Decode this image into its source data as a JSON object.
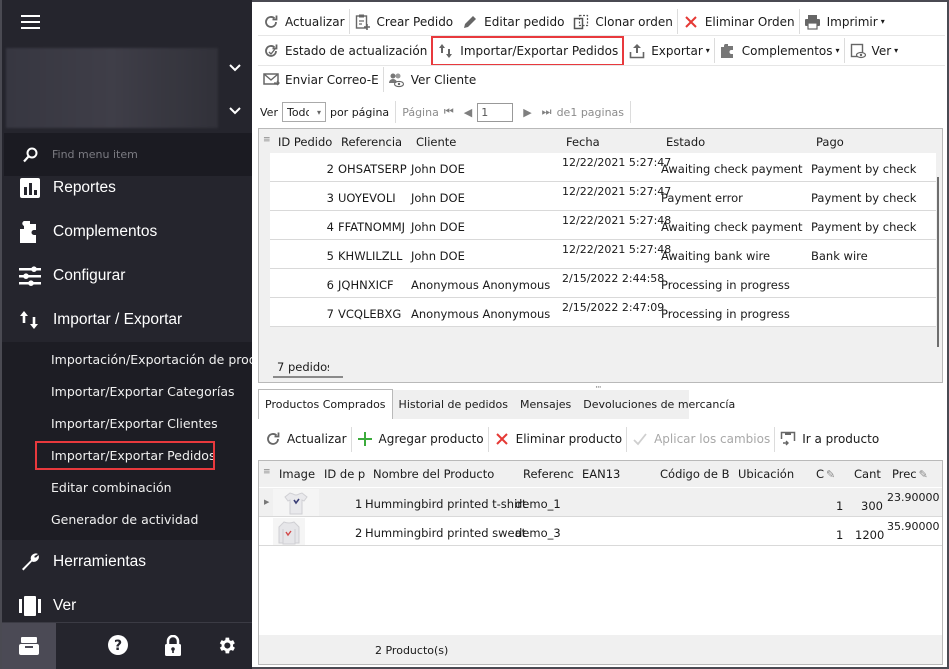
{
  "sidebar": {
    "search_placeholder": "Find menu item",
    "menu": [
      {
        "label": "Reportes",
        "icon": "bar-chart-icon"
      },
      {
        "label": "Complementos",
        "icon": "puzzle-icon"
      },
      {
        "label": "Configurar",
        "icon": "sliders-icon"
      },
      {
        "label": "Importar / Exportar",
        "icon": "import-export-icon"
      }
    ],
    "submenu": [
      {
        "label": "Importación/Exportación de prod..."
      },
      {
        "label": "Importar/Exportar Categorías"
      },
      {
        "label": "Importar/Exportar Clientes"
      },
      {
        "label": "Importar/Exportar Pedidos",
        "selected": true
      },
      {
        "label": "Editar combinación"
      },
      {
        "label": "Generador de actividad"
      }
    ],
    "menu_after": [
      {
        "label": "Herramientas",
        "icon": "wrench-icon"
      },
      {
        "label": "Ver",
        "icon": "view-columns-icon"
      }
    ]
  },
  "toolbar": {
    "row1": {
      "refresh": "Actualizar",
      "create_order": "Crear Pedido",
      "edit_order": "Editar pedido",
      "clone_order": "Clonar orden",
      "delete_order": "Eliminar Orden",
      "print": "Imprimir"
    },
    "row2": {
      "update_status": "Estado de actualización",
      "import_export_orders": "Importar/Exportar Pedidos",
      "export": "Exportar",
      "addons": "Complementos",
      "view": "Ver"
    },
    "row3": {
      "send_email": "Enviar Correo-E",
      "view_customer": "Ver Cliente"
    }
  },
  "pager": {
    "show_label": "Ver",
    "per_page_value": "Todo",
    "per_page_label": "por página",
    "page_label": "Página",
    "page_value": "1",
    "of_pages": "de1 paginas"
  },
  "orders": {
    "columns": [
      "ID Pedido",
      "Referencia",
      "Cliente",
      "Fecha",
      "Estado",
      "Pago"
    ],
    "rows": [
      {
        "id": "2",
        "ref": "OHSATSERP",
        "customer": "John DOE",
        "date": "12/22/2021 5:27:47",
        "status": "Awaiting check payment",
        "payment": "Payment by check"
      },
      {
        "id": "3",
        "ref": "UOYEVOLI",
        "customer": "John DOE",
        "date": "12/22/2021 5:27:47",
        "status": "Payment error",
        "payment": "Payment by check"
      },
      {
        "id": "4",
        "ref": "FFATNOMMJ",
        "customer": "John DOE",
        "date": "12/22/2021 5:27:48",
        "status": "Awaiting check payment",
        "payment": "Payment by check"
      },
      {
        "id": "5",
        "ref": "KHWLILZLL",
        "customer": "John DOE",
        "date": "12/22/2021 5:27:48",
        "status": "Awaiting bank wire",
        "payment": "Bank wire"
      },
      {
        "id": "6",
        "ref": "JQHNXICF",
        "customer": "Anonymous Anonymous",
        "date": "2/15/2022 2:44:58",
        "status": "Processing in progress",
        "payment": ""
      },
      {
        "id": "7",
        "ref": "VCQLEBXG",
        "customer": "Anonymous Anonymous",
        "date": "2/15/2022 2:47:09",
        "status": "Processing in progress",
        "payment": ""
      }
    ],
    "footer": "7 pedidos"
  },
  "tabs": [
    {
      "label": "Productos Comprados",
      "active": true
    },
    {
      "label": "Historial de pedidos"
    },
    {
      "label": "Mensajes"
    },
    {
      "label": "Devoluciones de mercancía"
    }
  ],
  "product_toolbar": {
    "refresh": "Actualizar",
    "add_product": "Agregar producto",
    "delete_product": "Eliminar producto",
    "apply_changes": "Aplicar los cambios",
    "go_to_product": "Ir a producto"
  },
  "products": {
    "columns": [
      "Image",
      "ID de p",
      "Nombre del Producto",
      "Referenc",
      "EAN13",
      "Código de Ba",
      "Ubicación",
      "C",
      "Cant",
      "Prec"
    ],
    "rows": [
      {
        "id": "1",
        "name": "Hummingbird printed t-shirt",
        "ref": "demo_1",
        "ean13": "",
        "barcode": "",
        "location": "",
        "c": "1",
        "qty": "300",
        "price": "23.90000"
      },
      {
        "id": "2",
        "name": "Hummingbird printed sweat",
        "ref": "demo_3",
        "ean13": "",
        "barcode": "",
        "location": "",
        "c": "1",
        "qty": "1200",
        "price": "35.90000"
      }
    ],
    "footer": "2 Producto(s)"
  },
  "colors": {
    "sidebar_bg": "#25252d",
    "highlight_red": "#e8393d",
    "delete_red": "#e53935",
    "add_green": "#3cab3c"
  }
}
